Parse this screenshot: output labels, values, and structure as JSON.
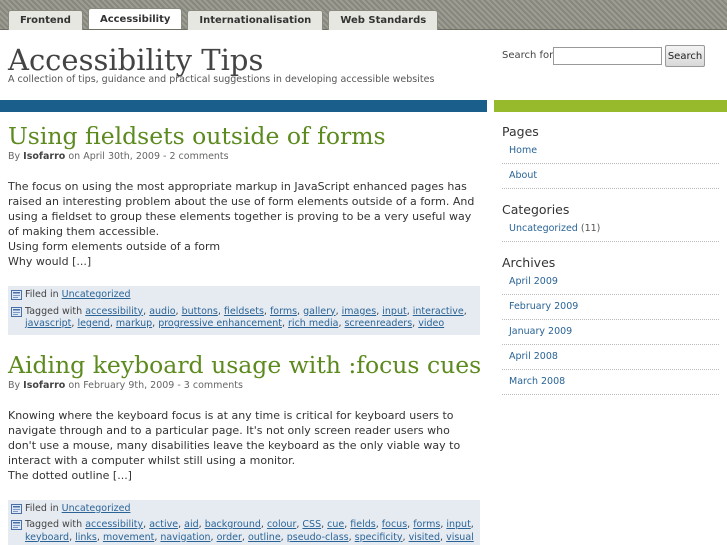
{
  "tabs": [
    "Frontend",
    "Accessibility",
    "Internationalisation",
    "Web Standards"
  ],
  "site": {
    "title": "Accessibility Tips",
    "description": "A collection of tips, guidance and practical suggestions in developing accessible websites"
  },
  "search": {
    "label": "Search for:",
    "button": "Search",
    "value": ""
  },
  "posts": [
    {
      "title": "Using fieldsets outside of forms",
      "by": "By",
      "author": "Isofarro",
      "on": "on April 30th, 2009 - 2 comments",
      "excerpt": [
        "The focus on using the most appropriate markup in JavaScript enhanced pages has raised an interesting problem about the use of form elements outside of a form. And using a fieldset to group these elements together is proving to be a very useful way of making them accessible.",
        "Using form elements outside of a form",
        "Why would [...]"
      ],
      "filed_label": "Filed in",
      "category": "Uncategorized",
      "tagged_label": "Tagged with",
      "tags": [
        "accessibility",
        "audio",
        "buttons",
        "fieldsets",
        "forms",
        "gallery",
        "images",
        "input",
        "interactive",
        "javascript",
        "legend",
        "markup",
        "progressive enhancement",
        "rich media",
        "screenreaders",
        "video"
      ]
    },
    {
      "title": "Aiding keyboard usage with :focus cues",
      "by": "By",
      "author": "Isofarro",
      "on": "on February 9th, 2009 - 3 comments",
      "excerpt": [
        "Knowing where the keyboard focus is at any time is critical for keyboard users to navigate through and to a particular page. It's not only screen reader users who don't use a mouse, many disabilities leave the keyboard as the only viable way to interact with a computer whilst still using a monitor.",
        "The dotted outline [...]"
      ],
      "filed_label": "Filed in",
      "category": "Uncategorized",
      "tagged_label": "Tagged with",
      "tags": [
        "accessibility",
        "active",
        "aid",
        "background",
        "colour",
        "CSS",
        "cue",
        "fields",
        "focus",
        "forms",
        "input",
        "keyboard",
        "links",
        "movement",
        "navigation",
        "order",
        "outline",
        "pseudo-class",
        "specificity",
        "visited",
        "visual"
      ]
    }
  ],
  "sidebar": {
    "pages": {
      "title": "Pages",
      "items": [
        "Home",
        "About"
      ]
    },
    "categories": {
      "title": "Categories",
      "items": [
        {
          "name": "Uncategorized",
          "count": "(11)"
        }
      ]
    },
    "archives": {
      "title": "Archives",
      "items": [
        "April 2009",
        "February 2009",
        "January 2009",
        "April 2008",
        "March 2008"
      ]
    }
  },
  "colors": {
    "post_title": "#5d8a1f",
    "link": "#2a6496",
    "bar_blue": "#1a5f8c",
    "bar_green": "#97ba2c"
  }
}
